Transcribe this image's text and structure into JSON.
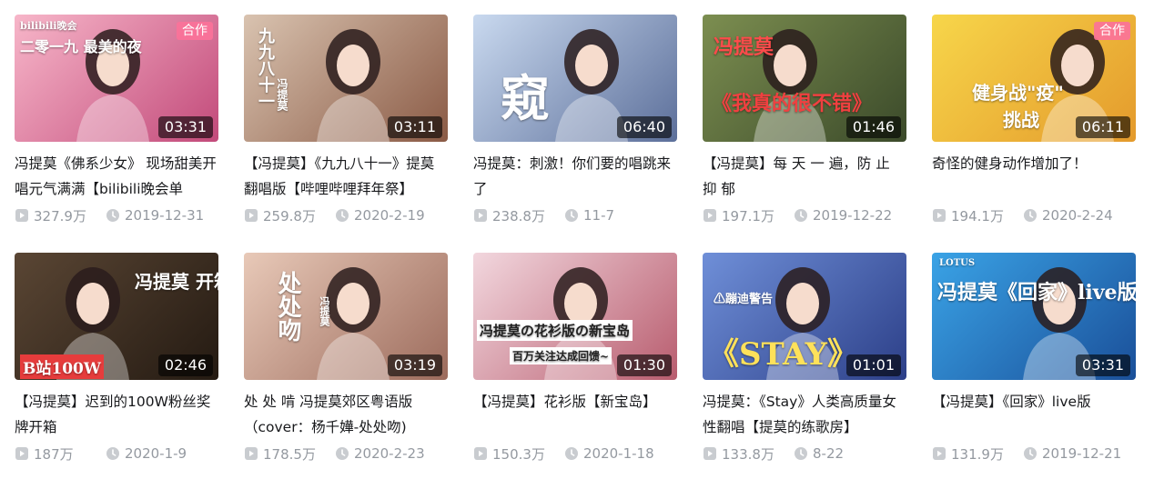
{
  "videos": [
    {
      "title": "冯提莫《佛系少女》 现场甜美开唱元气满满【bilibili晚会单",
      "duration": "03:31",
      "views": "327.9万",
      "date": "2019-12-31",
      "badge": "合作",
      "art": {
        "bg1": "#f7b6c9",
        "bg2": "#c24a7a",
        "overlay": "二零一九 最美的夜",
        "overlay_caption": "bilibili晚会"
      }
    },
    {
      "title": "【冯提莫】《九九八十一》提莫翻唱版【哔哩哔哩拜年祭】",
      "duration": "03:11",
      "views": "259.8万",
      "date": "2020-2-19",
      "badge": "",
      "art": {
        "bg1": "#d9c3b0",
        "bg2": "#8a5a45",
        "overlay": "九九八十一",
        "overlay_caption": "冯提莫"
      }
    },
    {
      "title": "冯提莫：刺激！你们要的唱跳来了",
      "duration": "06:40",
      "views": "238.8万",
      "date": "11-7",
      "badge": "",
      "art": {
        "bg1": "#c9d9ef",
        "bg2": "#5c6f9a",
        "overlay": "窥",
        "overlay_caption": ""
      }
    },
    {
      "title": "【冯提莫】每 天 一 遍，防 止 抑 郁",
      "duration": "01:46",
      "views": "197.1万",
      "date": "2019-12-22",
      "badge": "",
      "art": {
        "bg1": "#7c8e50",
        "bg2": "#3b4a2a",
        "overlay": "《我真的很不错》",
        "overlay_caption": "冯提莫"
      }
    },
    {
      "title": "奇怪的健身动作增加了！",
      "duration": "06:11",
      "views": "194.1万",
      "date": "2020-2-24",
      "badge": "合作",
      "art": {
        "bg1": "#f7d64a",
        "bg2": "#e49a2c",
        "overlay": "健身战\"疫\"",
        "overlay_caption": "挑战"
      }
    },
    {
      "title": "【冯提莫】迟到的100W粉丝奖牌开箱",
      "duration": "02:46",
      "views": "187万",
      "date": "2020-1-9",
      "badge": "",
      "art": {
        "bg1": "#5a4634",
        "bg2": "#241a12",
        "overlay": "冯提莫 开箱",
        "overlay_caption": "B站100W"
      }
    },
    {
      "title": "处 处 啃 冯提莫郊区粤语版（cover：杨千嬅-处处吻)",
      "duration": "03:19",
      "views": "178.5万",
      "date": "2020-2-23",
      "badge": "",
      "art": {
        "bg1": "#e8c9b8",
        "bg2": "#9c6b5c",
        "overlay": "处处吻",
        "overlay_caption": "冯提莫"
      }
    },
    {
      "title": "【冯提莫】花衫版【新宝岛】",
      "duration": "01:30",
      "views": "150.3万",
      "date": "2020-1-18",
      "badge": "",
      "art": {
        "bg1": "#f2d7de",
        "bg2": "#b85c6e",
        "overlay": "冯提莫の花衫版の新宝岛",
        "overlay_caption": "百万关注达成回馈~"
      }
    },
    {
      "title": "冯提莫：《Stay》人类高质量女性翻唱【提莫的练歌房】",
      "duration": "01:01",
      "views": "133.8万",
      "date": "8-22",
      "badge": "",
      "art": {
        "bg1": "#6f8fd8",
        "bg2": "#2c3f88",
        "overlay": "《STAY》",
        "overlay_caption": "⚠蹦迪警告"
      }
    },
    {
      "title": "【冯提莫】《回家》live版",
      "duration": "03:31",
      "views": "131.9万",
      "date": "2019-12-21",
      "badge": "",
      "art": {
        "bg1": "#3aa3e6",
        "bg2": "#1a4f99",
        "overlay": "冯提莫《回家》live版",
        "overlay_caption": "LOTUS"
      }
    }
  ],
  "icons": {
    "views": "play-count-icon",
    "date": "clock-icon"
  },
  "colors": {
    "accent": "#fb7299",
    "meta": "#9499a0",
    "title": "#18191c"
  }
}
